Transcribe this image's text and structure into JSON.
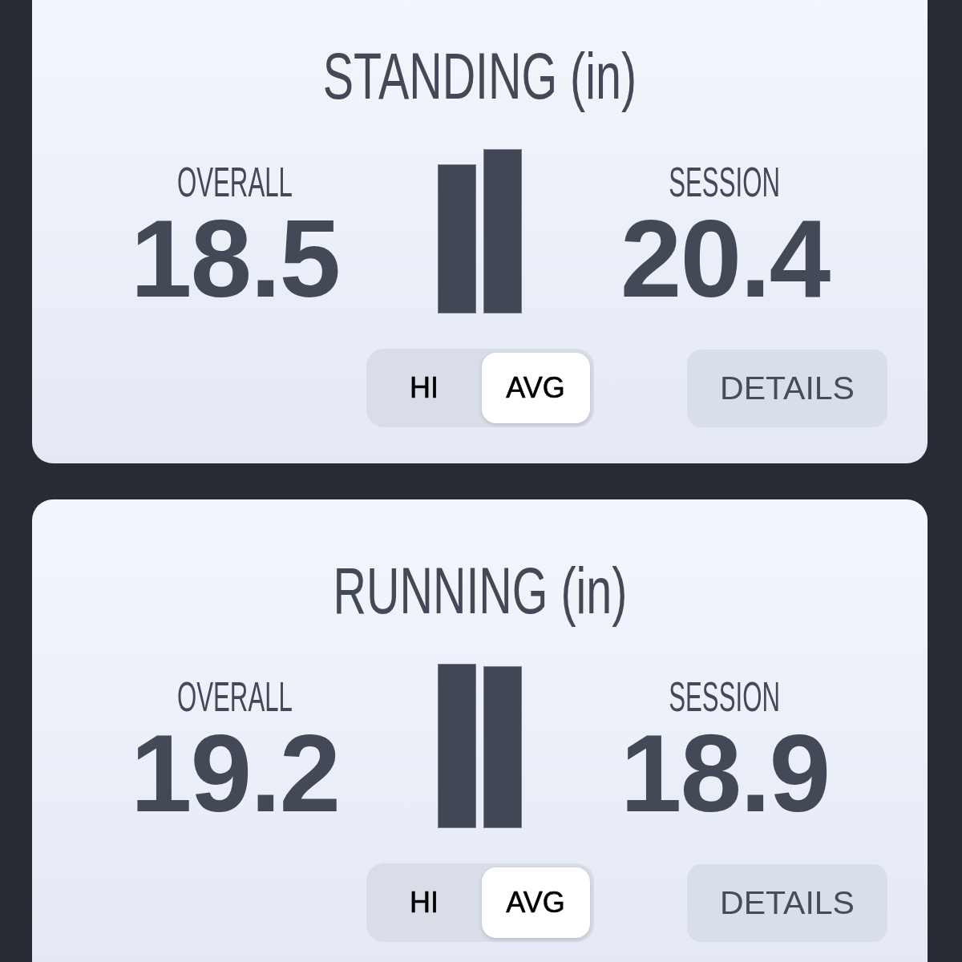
{
  "cards": [
    {
      "title": "STANDING (in)",
      "stats": [
        {
          "label": "OVERALL",
          "value": "18.5"
        },
        {
          "label": "SESSION",
          "value": "20.4"
        }
      ],
      "toggle": [
        {
          "label": "HI",
          "selected": false
        },
        {
          "label": "AVG",
          "selected": true
        }
      ],
      "details_button": "DETAILS"
    },
    {
      "title": "RUNNING (in)",
      "stats": [
        {
          "label": "OVERALL",
          "value": "19.2"
        },
        {
          "label": "SESSION",
          "value": "18.9"
        }
      ],
      "toggle": [
        {
          "label": "HI",
          "selected": false
        },
        {
          "label": "AVG",
          "selected": true
        }
      ],
      "details_button": "DETAILS"
    }
  ]
}
